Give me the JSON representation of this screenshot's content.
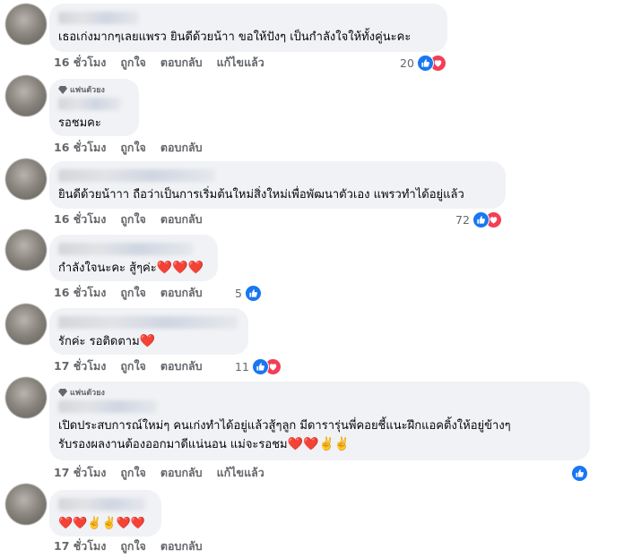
{
  "colors": {
    "bubble_bg": "#f0f2f5",
    "meta_text": "#65676b",
    "like_blue": "#1877f2",
    "love_red": "#f33e58"
  },
  "icons": {
    "like": "thumbs-up-icon",
    "love": "heart-icon",
    "fan_badge": "diamond-icon"
  },
  "actions": {
    "like": "ถูกใจ",
    "reply": "ตอบกลับ",
    "edited": "แก้ไขแล้ว"
  },
  "comments": [
    {
      "text": "เธอเก่งมากๆเลยแพรว ยินดีด้วยน้าา ขอให้ปังๆ เป็นกำลังใจให้ทั้งคู่นะคะ",
      "time": "16 ชั่วโมง",
      "edited": true,
      "reaction_count": "20"
    },
    {
      "badge": "แฟนตัวยง",
      "text": "รอชมคะ",
      "time": "16 ชั่วโมง"
    },
    {
      "text": "ยินดีด้วยน้าาา ถือว่าเป็นการเริ่มต้นใหม่สิ่งใหม่เพื่อพัฒนาตัวเอง แพรวทำได้อยู่แล้ว",
      "time": "16 ชั่วโมง",
      "reaction_count": "72"
    },
    {
      "text": "กำลังใจนะคะ สู้ๆค่ะ",
      "emoji": "❤️❤️❤️",
      "time": "16 ชั่วโมง",
      "reaction_count": "5"
    },
    {
      "text": "รักค่ะ รอติดตาม",
      "emoji": "❤️",
      "time": "17 ชั่วโมง",
      "reaction_count": "11"
    },
    {
      "badge": "แฟนตัวยง",
      "text_line1": "เปิดประสบการณ์ใหม่ๆ คนเก่งทำได้อยู่แล้วสู้ๆลูก มีดารารุ่นพี่คอยชี้แนะฝึกแอคติ้งให้อยู่ข้างๆ",
      "text_line2": "รับรองผลงานต้องออกมาดีแน่นอน แม่จะรอชม",
      "emoji": "❤️❤️✌️✌️",
      "time": "17 ชั่วโมง",
      "edited": true
    },
    {
      "text": "❤️❤️✌️✌️❤️❤️",
      "time": "17 ชั่วโมง"
    }
  ]
}
